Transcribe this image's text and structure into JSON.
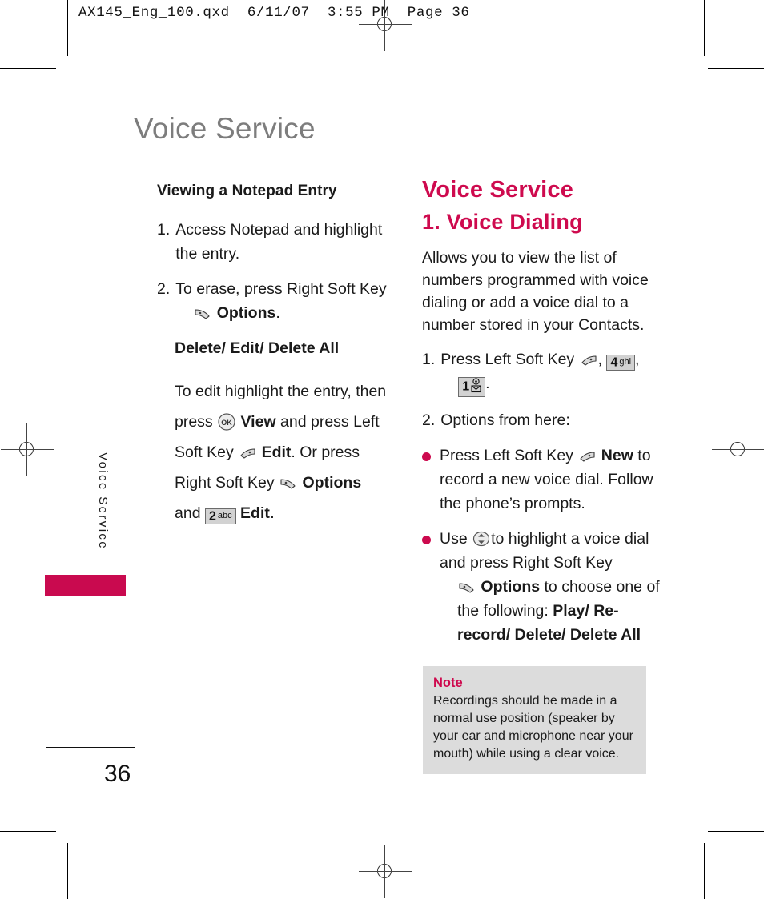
{
  "print_marks": {
    "slug_line": "AX145_Eng_100.qxd  6/11/07  3:55 PM  Page 36"
  },
  "page": {
    "title": "Voice Service",
    "folio": "36",
    "side_tab_label": "Voice Service",
    "accent_color": "#ce0a4e",
    "title_color": "#7d7d7d",
    "note_bg_color": "#dcdcdc"
  },
  "left_column": {
    "heading": "Viewing a Notepad Entry",
    "step1": {
      "number": "1.",
      "text": "Access Notepad and highlight the entry."
    },
    "step2": {
      "number": "2.",
      "text_before": "To erase, press Right Soft Key",
      "icon": "right-soft-key-icon",
      "label_bold": "Options",
      "text_after": "."
    },
    "options_line": "Delete/ Edit/ Delete All",
    "body": {
      "t1": "To edit highlight the entry, then press",
      "ok_icon": "ok-key-icon",
      "b1": "View",
      "t2": "and press Left Soft Key",
      "left_soft_icon": "left-soft-key-icon",
      "b2": "Edit",
      "t3": ". Or press Right Soft Key",
      "right_soft_icon": "right-soft-key-icon",
      "b3": "Options",
      "t4": "and",
      "key2": {
        "digit": "2",
        "letters": "abc"
      },
      "b4": "Edit."
    }
  },
  "right_column": {
    "section_title": "Voice Service",
    "subsection_title": "1. Voice Dialing",
    "intro": "Allows you to view the list of numbers programmed with voice dialing or add a voice dial  to a number stored in your Contacts.",
    "step1": {
      "number": "1.",
      "text": "Press Left Soft Key",
      "left_soft_icon": "left-soft-key-icon",
      "sep1": ",",
      "key4": {
        "digit": "4",
        "letters": "ghi"
      },
      "sep2": ",",
      "key1": {
        "digit": "1",
        "letters": "at-envelope"
      },
      "period": "."
    },
    "step2": {
      "number": "2.",
      "text": "Options from here:"
    },
    "bullets": [
      {
        "text_before": "Press Left Soft Key",
        "icon": "left-soft-key-icon",
        "label_bold": "New",
        "text_after": "to record a new voice dial. Follow the phone’s prompts."
      },
      {
        "text_before": "Use",
        "icon": "nav-up-down-icon",
        "text_mid": "to highlight a voice dial and press Right Soft Key",
        "icon2": "right-soft-key-icon",
        "label_bold": "Options",
        "text_after": "to choose one of the following:",
        "choices_bold": "Play/ Re-record/ Delete/ Delete All"
      }
    ]
  },
  "note": {
    "heading": "Note",
    "body": "Recordings should be made in a normal use position (speaker by your ear and microphone near your mouth) while using a clear voice."
  }
}
